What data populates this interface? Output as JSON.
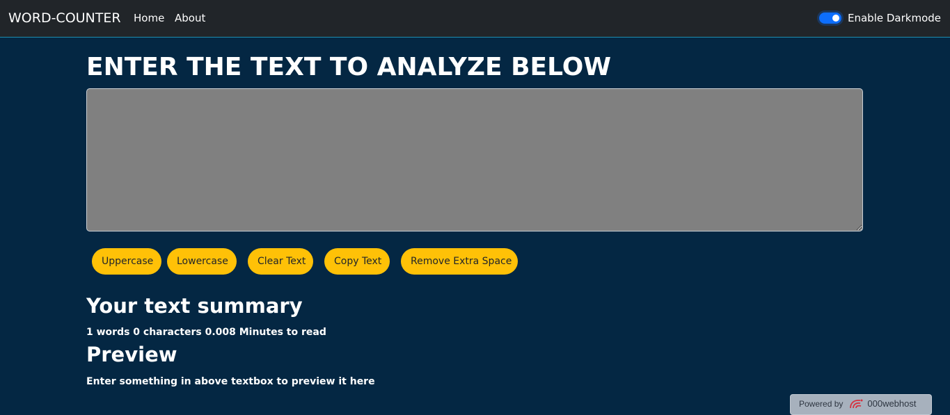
{
  "navbar": {
    "brand": "WORD-COUNTER",
    "links": [
      {
        "label": "Home"
      },
      {
        "label": "About"
      }
    ],
    "darkmode_label": "Enable Darkmode",
    "darkmode_enabled": true
  },
  "main": {
    "heading": "ENTER THE TEXT TO ANALYZE BELOW",
    "textbox_value": "",
    "buttons": [
      {
        "label": "Uppercase"
      },
      {
        "label": "Lowercase"
      },
      {
        "label": "Clear Text"
      },
      {
        "label": "Copy Text"
      },
      {
        "label": "Remove Extra Space"
      }
    ],
    "summary_title": "Your text summary",
    "summary_stats": "1 words 0 characters 0.008 Minutes to read",
    "preview_title": "Preview",
    "preview_text": "Enter something in above textbox to preview it here"
  },
  "footer_badge": {
    "powered_by": "Powered by",
    "host_name": "000webhost",
    "logo_icon": "000webhost-logo-icon"
  },
  "colors": {
    "background": "#042743",
    "navbar": "#212529",
    "button": "#ffc107",
    "textbox": "#808080",
    "toggle": "#0d6efd"
  }
}
